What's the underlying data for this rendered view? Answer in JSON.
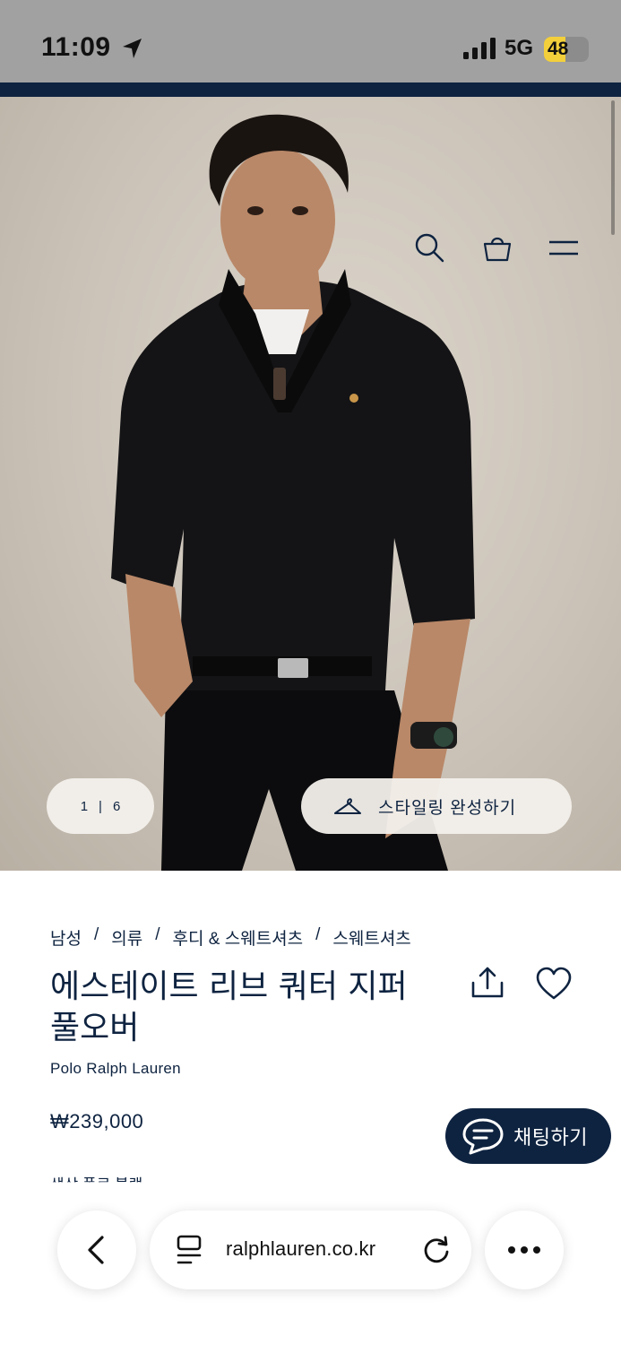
{
  "status_bar": {
    "time": "11:09",
    "network": "5G",
    "battery": "48",
    "battery_level": 0.48
  },
  "hero": {
    "pager": {
      "current": "1",
      "total": "6"
    },
    "styling_button": "스타일링 완성하기"
  },
  "product": {
    "breadcrumb": [
      "남성",
      "의류",
      "후디 & 스웨트셔츠",
      "스웨트셔츠"
    ],
    "title": "에스테이트 리브 쿼터 지퍼 풀오버",
    "brand": "Polo Ralph Lauren",
    "price": "₩239,000",
    "partial_text": "색상 폴로 블랙"
  },
  "chat": {
    "label": "채팅하기"
  },
  "browser": {
    "url": "ralphlauren.co.kr"
  },
  "colors": {
    "navy": "#0e2340",
    "status_gray": "#a1a1a1",
    "battery_yellow": "#f3d03b"
  },
  "icons": [
    "location-arrow-icon",
    "signal-icon",
    "search-icon",
    "bag-icon",
    "menu-icon",
    "hanger-icon",
    "share-icon",
    "heart-icon",
    "chat-bubble-icon",
    "back-chevron-icon",
    "reader-icon",
    "reload-icon",
    "more-icon"
  ]
}
